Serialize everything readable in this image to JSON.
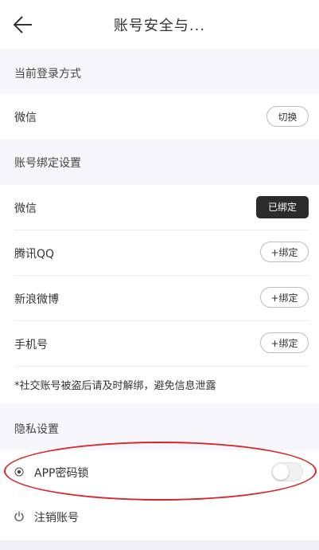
{
  "header": {
    "title": "账号安全与..."
  },
  "login_section": {
    "title": "当前登录方式",
    "row": {
      "label": "微信",
      "button": "切换"
    }
  },
  "binding_section": {
    "title": "账号绑定设置",
    "rows": [
      {
        "label": "微信",
        "button": "已绑定",
        "bound": true
      },
      {
        "label": "腾讯QQ",
        "button": "+绑定",
        "bound": false
      },
      {
        "label": "新浪微博",
        "button": "+绑定",
        "bound": false
      },
      {
        "label": "手机号",
        "button": "+绑定",
        "bound": false
      }
    ],
    "notice": "*社交账号被盗后请及时解绑，避免信息泄露"
  },
  "privacy_section": {
    "title": "隐私设置",
    "app_lock": {
      "label": "APP密码锁",
      "enabled": false,
      "icon": "target-radio-icon"
    },
    "cancel_account": {
      "label": "注销账号",
      "icon": "power-icon"
    }
  },
  "colors": {
    "page_background": "#f7f6fb",
    "bound_button_background": "#2b2b2b",
    "highlight_annotation": "#d8272b"
  }
}
